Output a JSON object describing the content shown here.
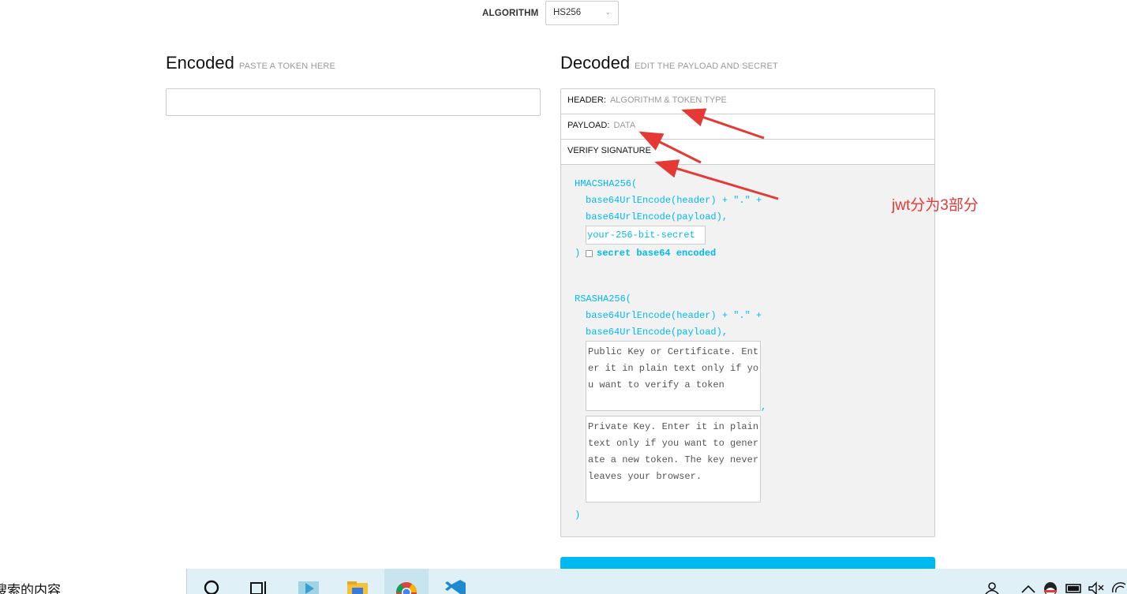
{
  "algorithm": {
    "label": "ALGORITHM",
    "selected": "HS256"
  },
  "encoded": {
    "title": "Encoded",
    "subtitle": "PASTE A TOKEN HERE",
    "token": ""
  },
  "decoded": {
    "title": "Decoded",
    "subtitle": "EDIT THE PAYLOAD AND SECRET",
    "header_label": "HEADER:",
    "header_desc": "ALGORITHM & TOKEN TYPE",
    "payload_label": "PAYLOAD:",
    "payload_desc": "DATA",
    "verify_label": "VERIFY SIGNATURE"
  },
  "hmac": {
    "fn": "HMACSHA256(",
    "line1": "base64UrlEncode(header) + \".\" +",
    "line2": "base64UrlEncode(payload),",
    "secret_placeholder": "your-256-bit-secret",
    "close": ")",
    "base64_label": "secret base64 encoded"
  },
  "rsa": {
    "fn": "RSASHA256(",
    "line1": "base64UrlEncode(header) + \".\" +",
    "line2": "base64UrlEncode(payload),",
    "public_key_placeholder": "Public Key or Certificate. Ent\ner it in plain text only if yo\nu want to verify a token",
    "comma": ",",
    "private_key_placeholder": "Private Key. Enter it in plain\ntext only if you want to gener\nate a new token. The key never\nleaves your browser.",
    "close": ")"
  },
  "annotation": {
    "text": "jwt分为3部分",
    "color": "#e53935"
  },
  "taskbar": {
    "search_text": "搜索的内容"
  },
  "colors": {
    "accent": "#00b9f1",
    "annotation": "#e53935"
  }
}
